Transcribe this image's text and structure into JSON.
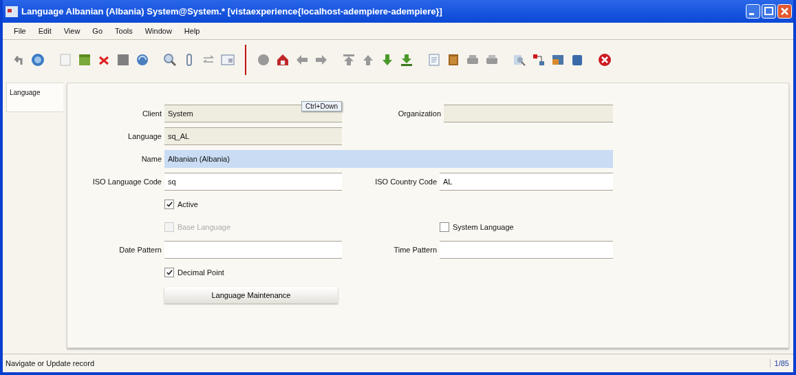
{
  "window": {
    "title": "Language  Albanian (Albania)  System@System.* [vistaexperience{localhost-adempiere-adempiere}]"
  },
  "menu": [
    "File",
    "Edit",
    "View",
    "Go",
    "Tools",
    "Window",
    "Help"
  ],
  "tabs": [
    {
      "label": "Language",
      "selected": true
    }
  ],
  "form": {
    "rows": [
      [
        {
          "kind": "field",
          "label": "Client",
          "value": "System",
          "readonly": true,
          "focused": false,
          "tooltip": "Ctrl+Down"
        },
        {
          "kind": "field",
          "label": "Organization",
          "readonly": true,
          "focused": false
        }
      ],
      [
        {
          "kind": "field",
          "label": "Language",
          "value": "sq_AL",
          "readonly": true,
          "focused": false
        }
      ],
      [
        {
          "kind": "wide-field",
          "label": "Name",
          "value": "Albanian (Albania)",
          "readonly": false,
          "focused": true
        }
      ],
      [
        {
          "kind": "field",
          "label": "ISO Language Code",
          "value": "sq",
          "readonly": false,
          "focused": false
        },
        {
          "kind": "field",
          "label": "ISO Country Code",
          "value": "AL",
          "readonly": false,
          "focused": false
        }
      ],
      [
        {
          "kind": "checkbox",
          "label": "Active",
          "checked": true,
          "disabled": false
        }
      ],
      [
        {
          "kind": "checkbox",
          "label": "Base Language",
          "checked": false,
          "disabled": true
        },
        {
          "kind": "checkbox",
          "label": "System Language",
          "checked": false,
          "disabled": false
        }
      ],
      [
        {
          "kind": "field",
          "label": "Date Pattern",
          "readonly": false,
          "focused": false
        },
        {
          "kind": "field",
          "label": "Time Pattern",
          "readonly": false,
          "focused": false
        }
      ],
      [
        {
          "kind": "checkbox",
          "label": "Decimal Point",
          "checked": true,
          "disabled": false
        }
      ],
      [
        {
          "kind": "button",
          "label": "Language Maintenance"
        }
      ]
    ]
  },
  "status_bar": {
    "message": "Navigate or Update record",
    "record": "1/85"
  }
}
